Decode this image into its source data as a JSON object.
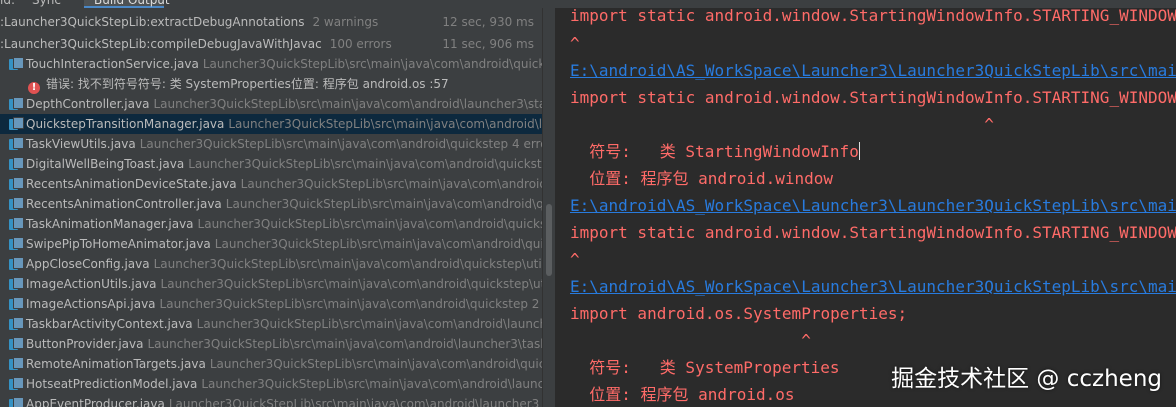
{
  "tabs": [
    "ld:",
    "Sync",
    "Build Output"
  ],
  "tree": {
    "tasks": [
      {
        "name": ":Launcher3QuickStepLib:extractDebugAnnotations",
        "meta": "2 warnings",
        "time": "12 sec, 930 ms"
      },
      {
        "name": ":Launcher3QuickStepLib:compileDebugJavaWithJavac",
        "meta": "100 errors",
        "time": "11 sec, 906 ms"
      }
    ],
    "files": [
      {
        "name": "TouchInteractionService.java",
        "path": "Launcher3QuickStepLib\\src\\main\\java\\com\\android\\quickst"
      },
      {
        "error": "错误: 找不到符号符号:  类 SystemProperties位置: 程序包 android.os :57"
      },
      {
        "name": "DepthController.java",
        "path": "Launcher3QuickStepLib\\src\\main\\java\\com\\android\\launcher3\\state"
      },
      {
        "name": "QuickstepTransitionManager.java",
        "path": "Launcher3QuickStepLib\\src\\main\\java\\com\\android\\la"
      },
      {
        "name": "TaskViewUtils.java",
        "path": "Launcher3QuickStepLib\\src\\main\\java\\com\\android\\quickstep 4 error"
      },
      {
        "name": "DigitalWellBeingToast.java",
        "path": "Launcher3QuickStepLib\\src\\main\\java\\com\\android\\quickstep"
      },
      {
        "name": "RecentsAnimationDeviceState.java",
        "path": "Launcher3QuickStepLib\\src\\main\\java\\com\\android\\qu"
      },
      {
        "name": "RecentsAnimationController.java",
        "path": "Launcher3QuickStepLib\\src\\main\\java\\com\\android\\qui"
      },
      {
        "name": "TaskAnimationManager.java",
        "path": "Launcher3QuickStepLib\\src\\main\\java\\com\\android\\quickst"
      },
      {
        "name": "SwipePipToHomeAnimator.java",
        "path": "Launcher3QuickStepLib\\src\\main\\java\\com\\android\\quic"
      },
      {
        "name": "AppCloseConfig.java",
        "path": "Launcher3QuickStepLib\\src\\main\\java\\com\\android\\quickstep\\util 2"
      },
      {
        "name": "ImageActionUtils.java",
        "path": "Launcher3QuickStepLib\\src\\main\\java\\com\\android\\quickstep\\util"
      },
      {
        "name": "ImageActionsApi.java",
        "path": "Launcher3QuickStepLib\\src\\main\\java\\com\\android\\quickstep 2 er"
      },
      {
        "name": "TaskbarActivityContext.java",
        "path": "Launcher3QuickStepLib\\src\\main\\java\\com\\android\\launcher"
      },
      {
        "name": "ButtonProvider.java",
        "path": "Launcher3QuickStepLib\\src\\main\\java\\com\\android\\launcher3\\taskb"
      },
      {
        "name": "RemoteAnimationTargets.java",
        "path": "Launcher3QuickStepLib\\src\\main\\java\\com\\android\\quick"
      },
      {
        "name": "HotseatPredictionModel.java",
        "path": "Launcher3QuickStepLib\\src\\main\\java\\com\\android\\launch"
      },
      {
        "name": "AppEventProducer.java",
        "path": "Launcher3QuickStepLib\\src\\main\\java\\com\\android\\launcher3"
      }
    ]
  },
  "console": {
    "lines": [
      "import static android.window.StartingWindowInfo.STARTING_WINDOW",
      "^",
      "E:\\android\\AS_WorkSpace\\Launcher3\\Launcher3QuickStepLib\\src\\main",
      "import static android.window.StartingWindowInfo.STARTING_WINDOW",
      "                                           ^",
      "  符号:   类 StartingWindowInfo",
      "  位置: 程序包 android.window",
      "E:\\android\\AS_WorkSpace\\Launcher3\\Launcher3QuickStepLib\\src\\main",
      "import static android.window.StartingWindowInfo.STARTING_WINDOW",
      "^",
      "E:\\android\\AS_WorkSpace\\Launcher3\\Launcher3QuickStepLib\\src\\main",
      "import android.os.SystemProperties;",
      "                        ^",
      "  符号:   类 SystemProperties",
      "  位置: 程序包 android.os"
    ]
  },
  "watermark": "掘金技术社区 @ cczheng",
  "colors": {
    "error_text": "#ff6b68",
    "link": "#287bde",
    "selection": "#0d293e",
    "panel_bg": "#3c3f41",
    "console_bg": "#2b2b2b"
  }
}
